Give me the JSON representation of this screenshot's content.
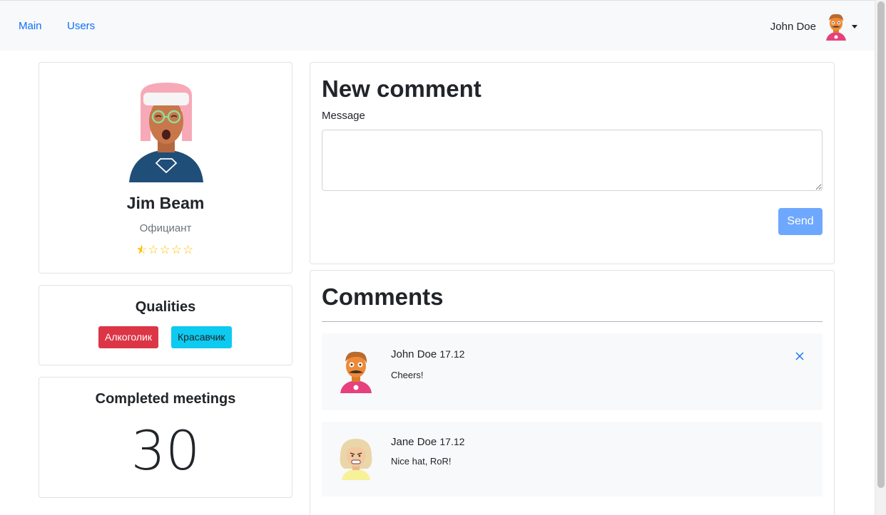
{
  "nav": {
    "links": [
      "Main",
      "Users"
    ],
    "user_name": "John Doe"
  },
  "profile": {
    "name": "Jim Beam",
    "profession": "Официант",
    "rating": 0.5,
    "max_rating": 5
  },
  "qualities": {
    "title": "Qualities",
    "badges": [
      {
        "label": "Алкоголик",
        "color": "#dc3545",
        "text_color": "#ffffff"
      },
      {
        "label": "Красавчик",
        "color": "#0dcaf0",
        "text_color": "#212529"
      }
    ]
  },
  "meetings": {
    "title": "Completed meetings",
    "count": "30"
  },
  "new_comment": {
    "title": "New comment",
    "message_label": "Message",
    "message_value": "",
    "send_label": "Send"
  },
  "comments": {
    "title": "Comments",
    "items": [
      {
        "author": "John Doe",
        "date": "17.12",
        "text": "Cheers!",
        "avatar": "man-mustache-avatar",
        "removable": true
      },
      {
        "author": "Jane Doe",
        "date": "17.12",
        "text": "Nice hat, RoR!",
        "avatar": "woman-blonde-avatar",
        "removable": false
      }
    ]
  },
  "colors": {
    "link": "#0d6efd",
    "navbar_bg": "#f8f9fa",
    "send_button": "#6ea8fe",
    "star": "#ffc107"
  }
}
